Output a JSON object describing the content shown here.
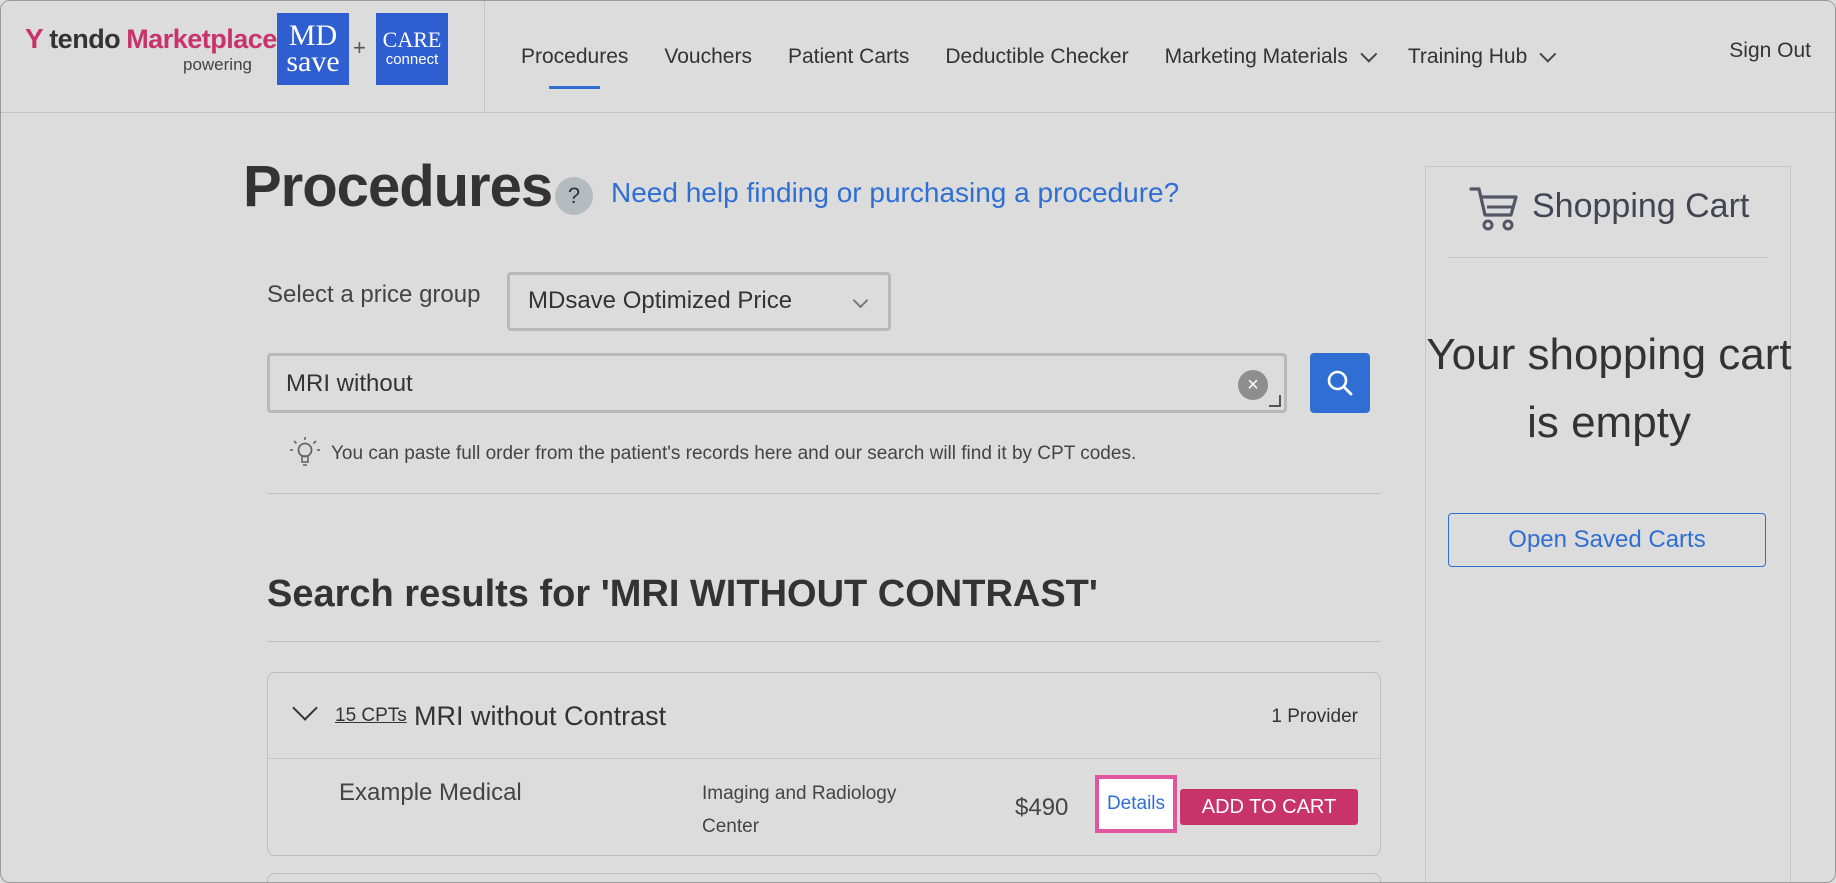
{
  "header": {
    "brand_mark": "Y",
    "brand_name": "tendo",
    "brand_marketplace": "Marketplace",
    "powering": "powering",
    "logo_md_line1": "MD",
    "logo_md_line2": "save",
    "logo_plus": "+",
    "logo_care_line1": "CARE",
    "logo_care_line2": "connect",
    "nav": [
      {
        "label": "Procedures",
        "active": true
      },
      {
        "label": "Vouchers"
      },
      {
        "label": "Patient Carts"
      },
      {
        "label": "Deductible Checker"
      },
      {
        "label": "Marketing Materials",
        "dropdown": true
      },
      {
        "label": "Training Hub",
        "dropdown": true
      }
    ],
    "sign_out": "Sign Out"
  },
  "main": {
    "title": "Procedures",
    "help_icon": "?",
    "help_link": "Need help finding or purchasing a procedure?",
    "price_group_label": "Select a price group",
    "price_group_value": "MDsave Optimized Price",
    "search_value": "MRI without",
    "clear_icon": "×",
    "tip": "You can paste full order from the patient's records here and our search will find it by CPT codes.",
    "results_title": "Search results for 'MRI WITHOUT CONTRAST'",
    "result": {
      "cpt_count": "15 CPTs",
      "procedure": "MRI without Contrast",
      "providers": "1 Provider",
      "provider_name": "Example Medical",
      "facility": "Imaging and Radiology Center",
      "price": "$490",
      "details": "Details",
      "add_to_cart": "ADD TO CART"
    }
  },
  "cart": {
    "title": "Shopping Cart",
    "empty": "Your shopping cart is empty",
    "open_saved": "Open Saved Carts"
  },
  "colors": {
    "accent_blue": "#2f6fd3",
    "brand_pink": "#c8336a",
    "highlight": "#e0559b"
  }
}
